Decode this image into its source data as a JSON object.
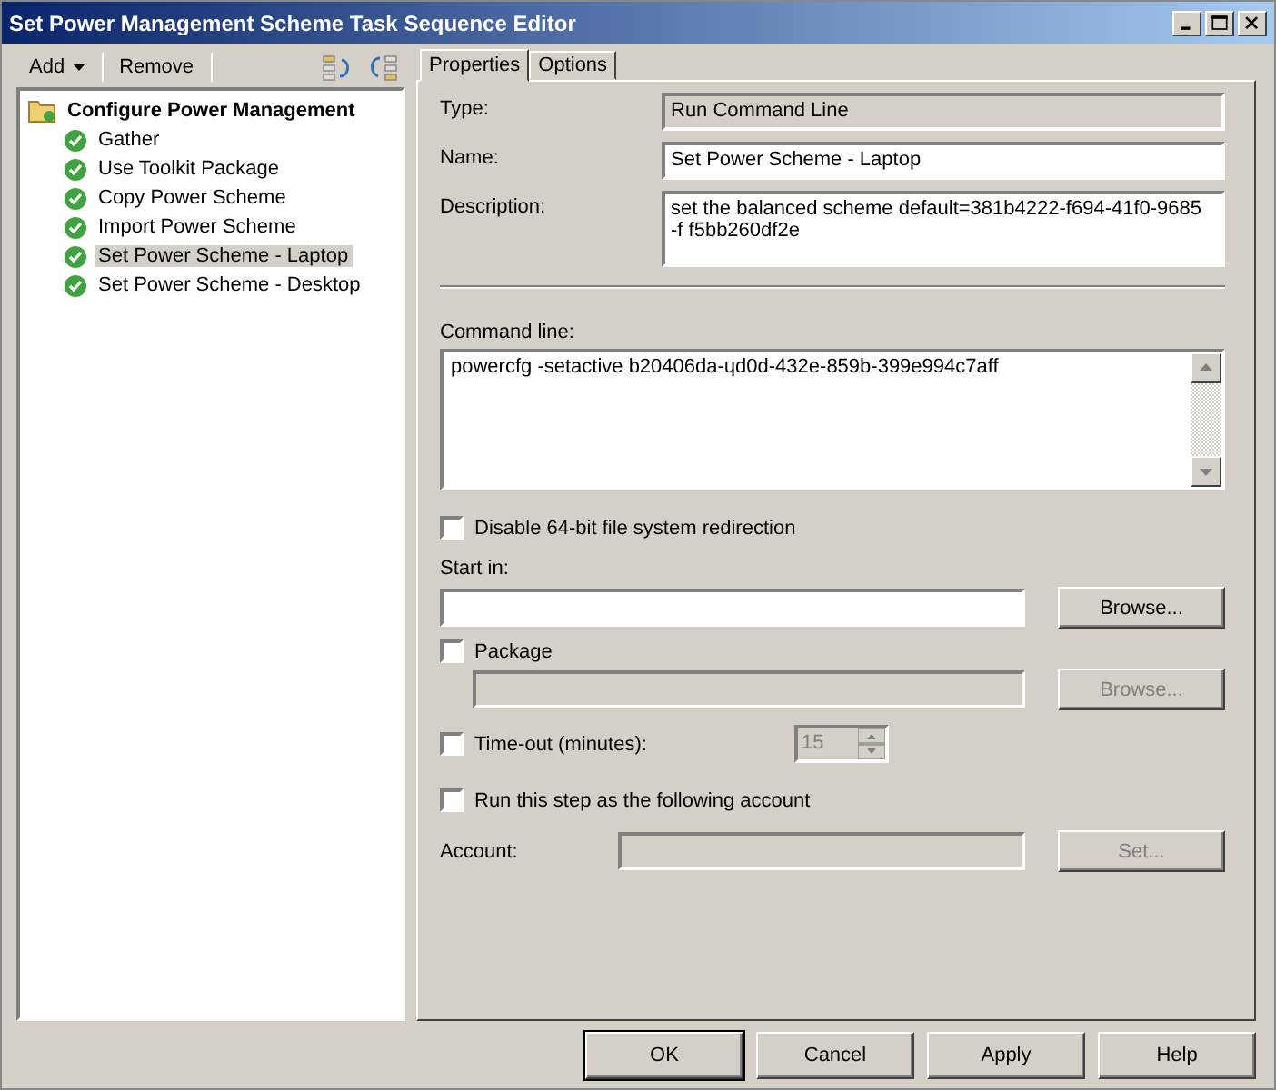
{
  "window": {
    "title": "Set Power Management Scheme Task Sequence Editor"
  },
  "toolbar": {
    "add": "Add",
    "remove": "Remove"
  },
  "tree": {
    "label": "Configure Power Management",
    "children": [
      {
        "label": "Gather",
        "selected": false
      },
      {
        "label": "Use Toolkit Package",
        "selected": false
      },
      {
        "label": "Copy Power Scheme",
        "selected": false
      },
      {
        "label": "Import Power Scheme",
        "selected": false
      },
      {
        "label": "Set Power Scheme - Laptop",
        "selected": true
      },
      {
        "label": "Set Power Scheme - Desktop",
        "selected": false
      }
    ]
  },
  "tabs": [
    {
      "label": "Properties",
      "selected": true
    },
    {
      "label": "Options",
      "selected": false
    }
  ],
  "properties": {
    "type": {
      "label": "Type:",
      "value": "Run Command Line"
    },
    "name": {
      "label": "Name:",
      "value": "Set Power Scheme - Laptop"
    },
    "description": {
      "label": "Description:",
      "value": "set the balanced scheme default=381b4222-f694-41f0-9685\n-f f5bb260df2e"
    },
    "command_line": {
      "label": "Command line:",
      "value": "powercfg -setactive b20406da-ɥd0d-432e-859b-399e994c7aff"
    },
    "disable_redirection": {
      "label": "Disable 64-bit file system redirection",
      "checked": false
    },
    "start_in": {
      "label": "Start in:",
      "browse": "Browse...",
      "disabled": false
    },
    "package": {
      "label": "Package",
      "checked": false,
      "browse": "Browse...",
      "disabled": true
    },
    "timeout": {
      "label": "Time-out (minutes):",
      "checked": false,
      "value": "15",
      "disabled": true
    },
    "run_as": {
      "label": "Run this step as the following account",
      "checked": false
    },
    "account": {
      "label": "Account:",
      "button": "Set...",
      "disabled": true
    }
  },
  "buttons": [
    "OK",
    "Cancel",
    "Apply",
    "Help"
  ]
}
